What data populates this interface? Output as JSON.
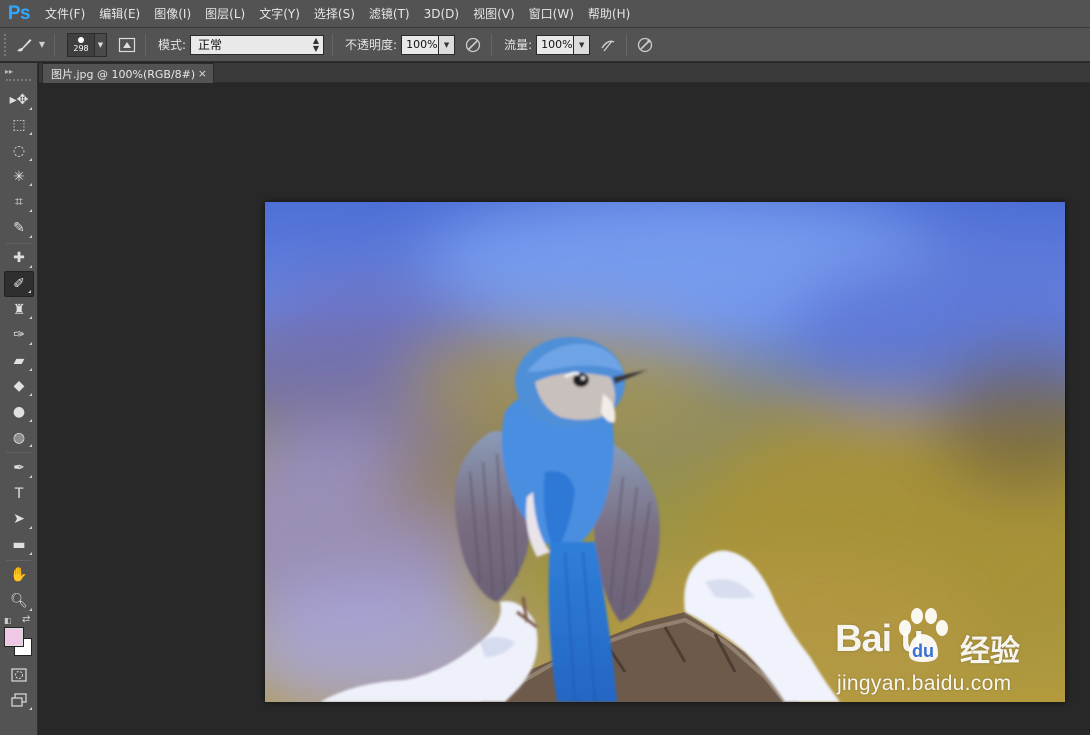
{
  "app": {
    "logo": "Ps"
  },
  "menu": [
    "文件(F)",
    "编辑(E)",
    "图像(I)",
    "图层(L)",
    "文字(Y)",
    "选择(S)",
    "滤镜(T)",
    "3D(D)",
    "视图(V)",
    "窗口(W)",
    "帮助(H)"
  ],
  "options": {
    "brush_size": "298",
    "mode_label": "模式:",
    "mode_value": "正常",
    "opacity_label": "不透明度:",
    "opacity_value": "100%",
    "flow_label": "流量:",
    "flow_value": "100%"
  },
  "document": {
    "tab_title": "图片.jpg @ 100%(RGB/8#)",
    "close_glyph": "×"
  },
  "tools": [
    {
      "name": "move-tool",
      "glyph": "▸✥"
    },
    {
      "name": "marquee-tool",
      "glyph": "⬚"
    },
    {
      "name": "lasso-tool",
      "glyph": "◌"
    },
    {
      "name": "magic-wand-tool",
      "glyph": "✳"
    },
    {
      "name": "crop-tool",
      "glyph": "⌗"
    },
    {
      "name": "eyedropper-tool",
      "glyph": "✎"
    },
    {
      "name": "healing-brush-tool",
      "glyph": "✚"
    },
    {
      "name": "brush-tool",
      "glyph": "✐",
      "active": true
    },
    {
      "name": "clone-stamp-tool",
      "glyph": "♜"
    },
    {
      "name": "history-brush-tool",
      "glyph": "✑"
    },
    {
      "name": "eraser-tool",
      "glyph": "▰"
    },
    {
      "name": "paint-bucket-tool",
      "glyph": "◆"
    },
    {
      "name": "blur-tool",
      "glyph": "●"
    },
    {
      "name": "dodge-tool",
      "glyph": "◍"
    },
    {
      "name": "pen-tool",
      "glyph": "✒"
    },
    {
      "name": "type-tool",
      "glyph": "T"
    },
    {
      "name": "path-selection-tool",
      "glyph": "➤"
    },
    {
      "name": "rectangle-tool",
      "glyph": "▬"
    },
    {
      "name": "hand-tool",
      "glyph": "✋"
    },
    {
      "name": "zoom-tool",
      "glyph": "🔍︎"
    }
  ],
  "colors": {
    "foreground": "#f0c8e6",
    "background": "#ffffff",
    "ps_blue": "#30a8ff"
  },
  "watermark": {
    "brand": "Bai  u",
    "jingyan": "经验",
    "domain": "jingyan.baidu.com"
  }
}
